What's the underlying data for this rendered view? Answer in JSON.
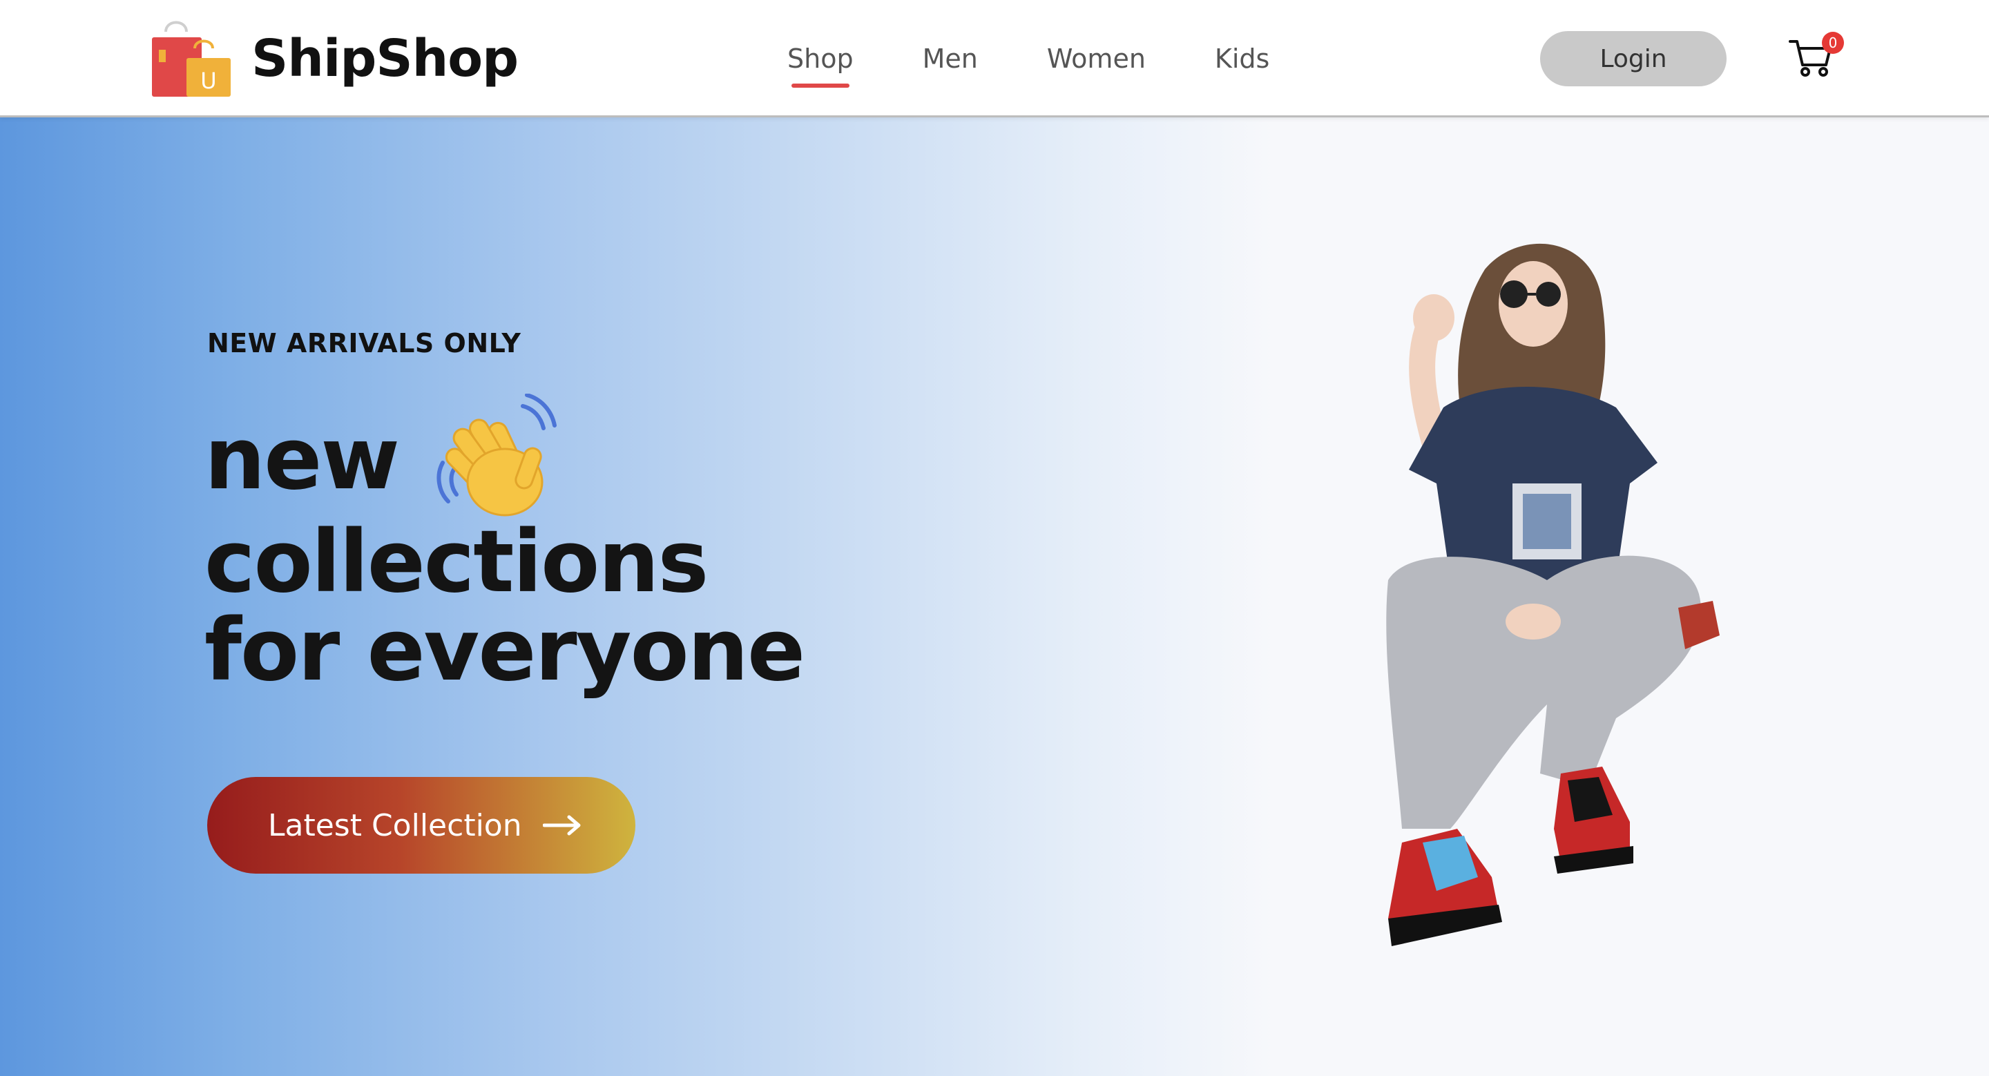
{
  "header": {
    "brand": "ShipShop",
    "nav": [
      {
        "label": "Shop",
        "active": true
      },
      {
        "label": "Men",
        "active": false
      },
      {
        "label": "Women",
        "active": false
      },
      {
        "label": "Kids",
        "active": false
      }
    ],
    "login_label": "Login",
    "cart_count": "0",
    "logo_bag_letter": "U"
  },
  "hero": {
    "eyebrow": "NEW ARRIVALS ONLY",
    "headline_line1": "new",
    "headline_line2": "collections",
    "headline_line3": "for everyone",
    "cta_label": "Latest Collection"
  },
  "colors": {
    "accent_underline": "#e04848",
    "cta_start": "#961c1c",
    "cta_end": "#cfb43e",
    "hero_gradient_left": "#5d97de",
    "cart_badge": "#e53935"
  },
  "icons": {
    "logo": "shopping-bags-icon",
    "cart": "cart-icon",
    "wave": "waving-hand-icon",
    "arrow": "arrow-right-icon"
  }
}
